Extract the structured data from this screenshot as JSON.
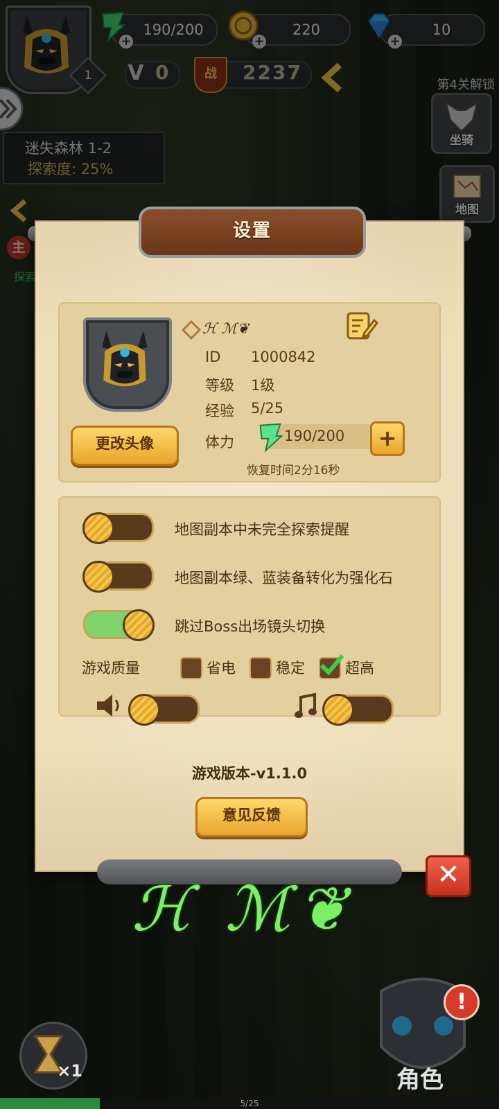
{
  "hud": {
    "player_level": "1",
    "stamina": "190/200",
    "gold": "220",
    "gems": "10",
    "vip": "0",
    "power_icon_label": "战",
    "power": "2237",
    "unlock_tip": "第4关解锁",
    "mount_label": "坐骑",
    "map_label": "地图",
    "quest_tab_label": "主",
    "explore_tab_label": "探索"
  },
  "stage": {
    "name": "迷失森林 1-2",
    "progress": "探索度: 25%"
  },
  "settings": {
    "title": "设置",
    "profile": {
      "nickname": "ℋ ℳ❦",
      "id_label": "ID",
      "id_value": "1000842",
      "level_label": "等级",
      "level_value": "1级",
      "exp_label": "经验",
      "exp_value": "5/25",
      "stamina_label": "体力",
      "stamina_value": "190/200",
      "stamina_fraction": 0.95,
      "recover_text": "恢复时间2分16秒",
      "change_avatar_button": "更改头像",
      "stamina_plus": "+"
    },
    "options": {
      "explore_reminder": {
        "label": "地图副本中未完全探索提醒",
        "enabled": false
      },
      "convert_gear": {
        "label": "地图副本绿、蓝装备转化为强化石",
        "enabled": false
      },
      "skip_boss_cam": {
        "label": "跳过Boss出场镜头切换",
        "enabled": true
      },
      "quality_label": "游戏质量",
      "quality_options": [
        "省电",
        "稳定",
        "超高"
      ],
      "quality_selected": "超高",
      "sound_enabled": false,
      "music_enabled": false
    },
    "version": "游戏版本-v1.1.0",
    "feedback_button": "意见反馈",
    "close_symbol": "✕"
  },
  "watermark": "ℋ ℳ❦",
  "bottom": {
    "speed_label": "×1",
    "role_label": "角色",
    "alert_symbol": "!",
    "page_indicator": "5/25",
    "page_progress_fraction": 0.2
  },
  "colors": {
    "dialog_bg": "#efdfbb",
    "toggle_on": "#7fd36a",
    "toggle_off": "#5a3a1c",
    "button_gold": "#e8a52c",
    "close_red": "#c8321e",
    "watermark_green": "#7bf064"
  }
}
